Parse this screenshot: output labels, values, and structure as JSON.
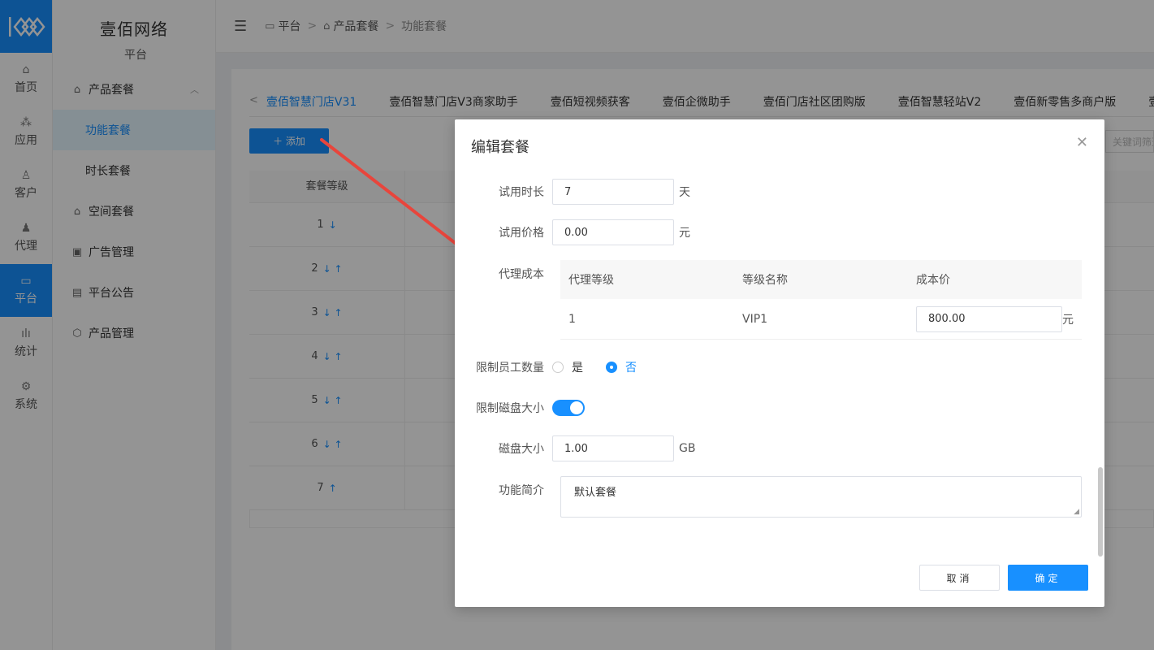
{
  "rail": {
    "items": [
      {
        "label": "首页",
        "icon": "home-icon",
        "glyph": "⌂"
      },
      {
        "label": "应用",
        "icon": "apps-icon",
        "glyph": "⁂"
      },
      {
        "label": "客户",
        "icon": "user-icon",
        "glyph": "♙"
      },
      {
        "label": "代理",
        "icon": "agent-icon",
        "glyph": "♟"
      },
      {
        "label": "平台",
        "icon": "monitor-icon",
        "glyph": "▭"
      },
      {
        "label": "统计",
        "icon": "stats-icon",
        "glyph": "ılı"
      },
      {
        "label": "系统",
        "icon": "settings-icon",
        "glyph": "⚙"
      }
    ],
    "active_index": 4
  },
  "sidebar": {
    "brand_name": "壹佰网络",
    "brand_sub": "平台",
    "items": [
      {
        "label": "产品套餐",
        "icon": "shop-icon",
        "glyph": "⌂",
        "type": "parent"
      },
      {
        "label": "功能套餐",
        "type": "child",
        "active": true
      },
      {
        "label": "时长套餐",
        "type": "child"
      },
      {
        "label": "空间套餐",
        "icon": "shop-icon",
        "glyph": "⌂",
        "type": "parent"
      },
      {
        "label": "广告管理",
        "icon": "ad-icon",
        "glyph": "▣",
        "type": "parent"
      },
      {
        "label": "平台公告",
        "icon": "notice-icon",
        "glyph": "▤",
        "type": "parent"
      },
      {
        "label": "产品管理",
        "icon": "box-icon",
        "glyph": "⬡",
        "type": "parent"
      }
    ]
  },
  "header": {
    "crumb": [
      "平台",
      "产品套餐",
      "功能套餐"
    ]
  },
  "tabs": [
    "壹佰智慧门店V31",
    "壹佰智慧门店V3商家助手",
    "壹佰短视频获客",
    "壹佰企微助手",
    "壹佰门店社区团购版",
    "壹佰智慧轻站V2",
    "壹佰新零售多商户版",
    "壹"
  ],
  "toolbar": {
    "add_label": "＋ 添加",
    "keyword_placeholder": "关键词筛选"
  },
  "table": {
    "header": "套餐等级",
    "rows": [
      {
        "level": "1",
        "arrows": "↓"
      },
      {
        "level": "2",
        "arrows": "↓ ↑"
      },
      {
        "level": "3",
        "arrows": "↓ ↑"
      },
      {
        "level": "4",
        "arrows": "↓ ↑"
      },
      {
        "level": "5",
        "arrows": "↓ ↑"
      },
      {
        "level": "6",
        "arrows": "↓ ↑"
      },
      {
        "level": "7",
        "arrows": "↑"
      }
    ]
  },
  "dialog": {
    "title": "编辑套餐",
    "trial_days_label": "试用时长",
    "trial_days_value": "7",
    "trial_days_unit": "天",
    "trial_price_label": "试用价格",
    "trial_price_value": "0.00",
    "trial_price_unit": "元",
    "agent_cost_label": "代理成本",
    "agent_cost_table": {
      "headers": [
        "代理等级",
        "等级名称",
        "成本价"
      ],
      "rows": [
        {
          "level": "1",
          "name": "VIP1",
          "cost": "800.00",
          "unit": "元"
        }
      ]
    },
    "limit_staff_label": "限制员工数量",
    "limit_staff_yes": "是",
    "limit_staff_no": "否",
    "limit_staff_selected": "否",
    "limit_disk_label": "限制磁盘大小",
    "limit_disk_on": true,
    "disk_size_label": "磁盘大小",
    "disk_size_value": "1.00",
    "disk_size_unit": "GB",
    "intro_label": "功能简介",
    "intro_value": "默认套餐",
    "cancel_label": "取消",
    "ok_label": "确定"
  },
  "colors": {
    "primary": "#1890ff",
    "annotation_arrow": "#e8453c"
  }
}
